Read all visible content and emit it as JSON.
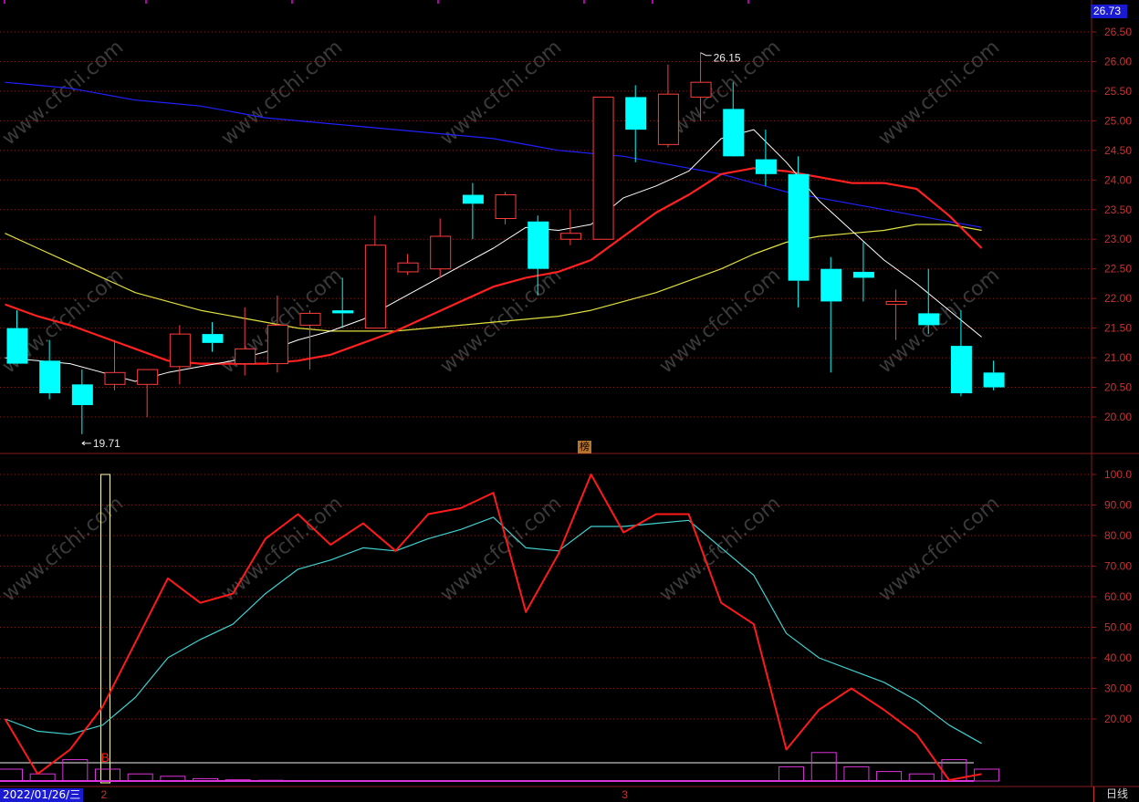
{
  "header": {
    "last_price": "26.73",
    "flag_char": "榜"
  },
  "footer": {
    "date_label": "2022/01/26/三",
    "period_label": "日线",
    "month_labels": [
      {
        "text": "2",
        "index": 3
      },
      {
        "text": "3",
        "index": 19
      }
    ]
  },
  "watermark": "www.cfchi.com",
  "colors": {
    "up": "#ff3c3c",
    "down": "#00ffff",
    "ma5": "#ffffff",
    "ma10": "#ff2020",
    "ma20": "#e0e040",
    "ma60": "#2020ff",
    "osc_fast": "#ff1a1a",
    "osc_slow": "#40d0d0",
    "osc_hist": "#dd33dd",
    "grid": "#8a1a1a"
  },
  "chart_data": [
    {
      "type": "candlestick",
      "y_ticks": [
        "20.00",
        "20.50",
        "21.00",
        "21.50",
        "22.00",
        "22.50",
        "23.00",
        "23.50",
        "24.00",
        "24.50",
        "25.00",
        "25.50",
        "26.00",
        "26.50"
      ],
      "ylim": [
        19.5,
        26.73
      ],
      "candles": [
        {
          "open": 21.5,
          "high": 21.8,
          "low": 20.9,
          "close": 20.9
        },
        {
          "open": 20.95,
          "high": 21.3,
          "low": 20.3,
          "close": 20.4
        },
        {
          "open": 20.55,
          "high": 20.8,
          "low": 19.71,
          "close": 20.2
        },
        {
          "open": 20.55,
          "high": 21.3,
          "low": 20.45,
          "close": 20.75
        },
        {
          "open": 20.55,
          "high": 20.8,
          "low": 20.0,
          "close": 20.8
        },
        {
          "open": 20.85,
          "high": 21.55,
          "low": 20.55,
          "close": 21.4
        },
        {
          "open": 21.4,
          "high": 21.6,
          "low": 21.1,
          "close": 21.25
        },
        {
          "open": 20.9,
          "high": 21.85,
          "low": 20.7,
          "close": 21.15
        },
        {
          "open": 20.9,
          "high": 22.05,
          "low": 20.75,
          "close": 21.55
        },
        {
          "open": 21.55,
          "high": 21.8,
          "low": 20.8,
          "close": 21.75
        },
        {
          "open": 21.8,
          "high": 22.35,
          "low": 21.5,
          "close": 21.75
        },
        {
          "open": 21.5,
          "high": 23.4,
          "low": 21.5,
          "close": 22.9
        },
        {
          "open": 22.45,
          "high": 22.75,
          "low": 22.4,
          "close": 22.6
        },
        {
          "open": 22.5,
          "high": 23.35,
          "low": 22.35,
          "close": 23.05
        },
        {
          "open": 23.75,
          "high": 23.95,
          "low": 23.0,
          "close": 23.6
        },
        {
          "open": 23.35,
          "high": 23.8,
          "low": 23.25,
          "close": 23.75
        },
        {
          "open": 23.3,
          "high": 23.4,
          "low": 22.05,
          "close": 22.5
        },
        {
          "open": 23.0,
          "high": 23.5,
          "low": 22.9,
          "close": 23.1
        },
        {
          "open": 23.0,
          "high": 25.4,
          "low": 23.0,
          "close": 25.4
        },
        {
          "open": 25.4,
          "high": 25.6,
          "low": 24.3,
          "close": 24.85
        },
        {
          "open": 24.6,
          "high": 25.95,
          "low": 24.55,
          "close": 25.45
        },
        {
          "open": 25.4,
          "high": 26.15,
          "low": 25.0,
          "close": 25.65
        },
        {
          "open": 25.2,
          "high": 25.65,
          "low": 24.45,
          "close": 24.4
        },
        {
          "open": 24.35,
          "high": 24.85,
          "low": 23.9,
          "close": 24.1
        },
        {
          "open": 24.1,
          "high": 24.4,
          "low": 21.85,
          "close": 22.3
        },
        {
          "open": 22.5,
          "high": 22.7,
          "low": 20.75,
          "close": 21.95
        },
        {
          "open": 22.45,
          "high": 22.95,
          "low": 21.95,
          "close": 22.35
        },
        {
          "open": 21.9,
          "high": 22.15,
          "low": 21.3,
          "close": 21.95
        },
        {
          "open": 21.75,
          "high": 22.5,
          "low": 21.4,
          "close": 21.55
        },
        {
          "open": 21.2,
          "high": 21.8,
          "low": 20.35,
          "close": 20.4
        },
        {
          "open": 20.75,
          "high": 20.95,
          "low": 20.45,
          "close": 20.5
        }
      ],
      "ma5": [
        21.0,
        20.95,
        20.9,
        20.75,
        20.6,
        20.75,
        20.85,
        20.95,
        21.1,
        21.3,
        21.45,
        21.65,
        21.95,
        22.25,
        22.55,
        22.85,
        23.2,
        23.15,
        23.25,
        23.7,
        23.9,
        24.15,
        24.7,
        24.85,
        24.3,
        23.65,
        23.15,
        22.65,
        22.25,
        21.8,
        21.35
      ],
      "ma10": [
        21.9,
        21.7,
        21.55,
        21.35,
        21.15,
        20.95,
        20.9,
        20.9,
        20.9,
        20.95,
        21.05,
        21.25,
        21.45,
        21.7,
        21.95,
        22.2,
        22.35,
        22.45,
        22.65,
        23.05,
        23.45,
        23.75,
        24.1,
        24.2,
        24.15,
        24.05,
        23.95,
        23.95,
        23.85,
        23.4,
        22.85
      ],
      "ma20": [
        23.1,
        22.85,
        22.6,
        22.35,
        22.1,
        21.95,
        21.8,
        21.7,
        21.6,
        21.5,
        21.45,
        21.45,
        21.45,
        21.5,
        21.55,
        21.6,
        21.65,
        21.7,
        21.8,
        21.95,
        22.1,
        22.3,
        22.5,
        22.75,
        22.95,
        23.05,
        23.1,
        23.15,
        23.25,
        23.25,
        23.15
      ],
      "ma60": [
        25.65,
        25.6,
        25.55,
        25.45,
        25.35,
        25.3,
        25.25,
        25.15,
        25.05,
        25.0,
        24.95,
        24.9,
        24.85,
        24.8,
        24.75,
        24.7,
        24.6,
        24.5,
        24.45,
        24.4,
        24.3,
        24.2,
        24.1,
        23.95,
        23.8,
        23.7,
        23.6,
        23.5,
        23.4,
        23.3,
        23.2
      ],
      "annotations": [
        {
          "text": "26.15",
          "index": 21,
          "value": 26.15
        },
        {
          "text": "19.71",
          "index": 2,
          "value": 19.71
        }
      ]
    },
    {
      "type": "line",
      "y_ticks": [
        "20.00",
        "30.00",
        "40.00",
        "50.00",
        "60.00",
        "70.00",
        "80.00",
        "90.00",
        "100.0"
      ],
      "ylim": [
        0,
        100
      ],
      "marker_text": "B",
      "marker_index": 3,
      "fast": [
        20,
        2,
        10,
        24,
        45,
        66,
        58,
        61,
        79,
        87,
        77,
        84,
        75,
        87,
        89,
        94,
        55,
        74,
        100,
        81,
        87,
        87,
        58,
        51,
        10,
        23,
        30,
        23,
        15,
        0,
        2
      ],
      "slow": [
        20,
        16,
        15,
        18,
        27,
        40,
        46,
        51,
        61,
        69,
        72,
        76,
        75,
        79,
        82,
        86,
        76,
        75,
        83,
        83,
        84,
        85,
        76,
        67,
        48,
        40,
        36,
        32,
        26,
        18,
        12
      ],
      "hist": [
        5,
        3,
        9,
        5,
        3,
        2,
        1,
        0.5,
        0.3,
        0.2,
        0.1,
        0.1,
        0.1,
        0.1,
        0.1,
        0.1,
        0.1,
        0.1,
        0.1,
        0.1,
        0.1,
        0.1,
        0.1,
        0.1,
        6,
        12,
        6,
        4,
        3,
        9,
        5
      ]
    }
  ]
}
